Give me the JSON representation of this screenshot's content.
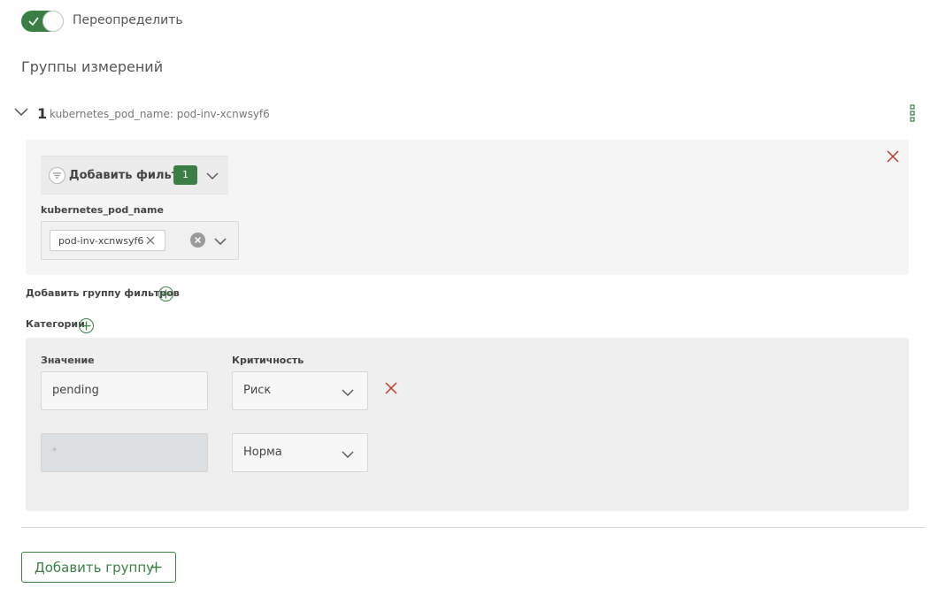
{
  "override": {
    "label": "Переопределить",
    "enabled": true
  },
  "section_title": "Группы измерений",
  "group": {
    "number": "1",
    "subtitle": "kubernetes_pod_name: pod-inv-xcnwsyf6",
    "filter": {
      "add_filter_label": "Добавить фильтр",
      "count": "1",
      "field_label": "kubernetes_pod_name",
      "tag_value": "pod-inv-xcnwsyf6"
    },
    "add_filter_group_label": "Добавить группу фильтров",
    "categories_label": "Категории",
    "categories": {
      "value_header": "Значение",
      "criticality_header": "Критичность",
      "rows": [
        {
          "value": "pending",
          "criticality": "Риск"
        },
        {
          "value": "*",
          "criticality": "Норма"
        }
      ]
    }
  },
  "add_group_label": "Добавить группу",
  "colors": {
    "accent": "#3c7f45",
    "danger": "#c0392b"
  },
  "icons": [
    "check-icon",
    "chevron-down-icon",
    "kebab-menu-icon",
    "close-icon",
    "filter-icon",
    "plus-icon",
    "clear-icon"
  ]
}
